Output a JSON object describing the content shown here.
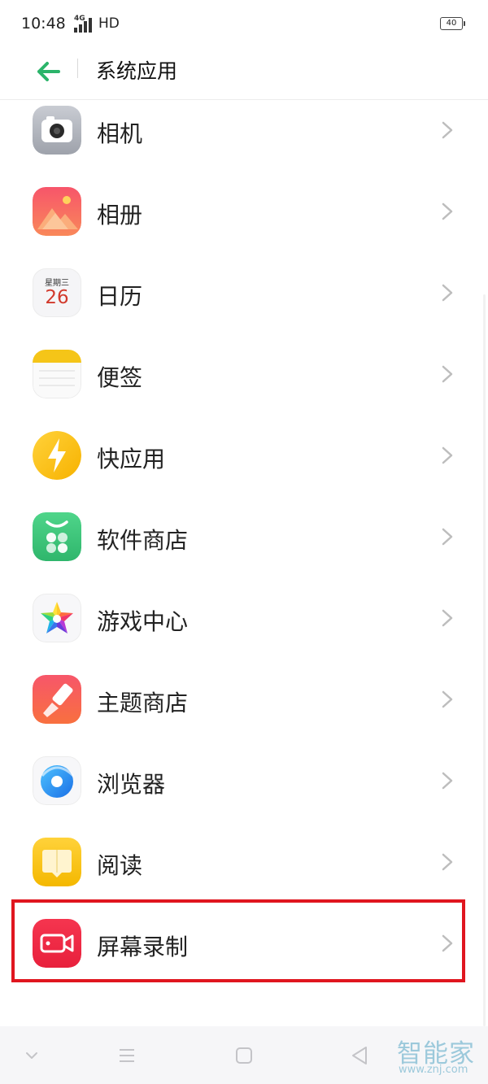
{
  "status_bar": {
    "time": "10:48",
    "network": "4G",
    "hd": "HD",
    "battery": "40"
  },
  "header": {
    "title": "系统应用"
  },
  "apps": [
    {
      "label": "相机"
    },
    {
      "label": "相册"
    },
    {
      "label": "日历",
      "icon_weekday": "星期三",
      "icon_day": "26"
    },
    {
      "label": "便签"
    },
    {
      "label": "快应用"
    },
    {
      "label": "软件商店"
    },
    {
      "label": "游戏中心"
    },
    {
      "label": "主题商店"
    },
    {
      "label": "浏览器"
    },
    {
      "label": "阅读"
    },
    {
      "label": "屏幕录制"
    }
  ],
  "watermark": {
    "name": "智能家",
    "url": "www.znj.com"
  },
  "colors": {
    "accent": "#2bb46a",
    "highlight": "#e0161f"
  },
  "icons": [
    "back-arrow-icon",
    "chevron-right-icon",
    "nav-down-icon",
    "nav-menu-icon",
    "nav-home-icon",
    "nav-back-icon"
  ]
}
